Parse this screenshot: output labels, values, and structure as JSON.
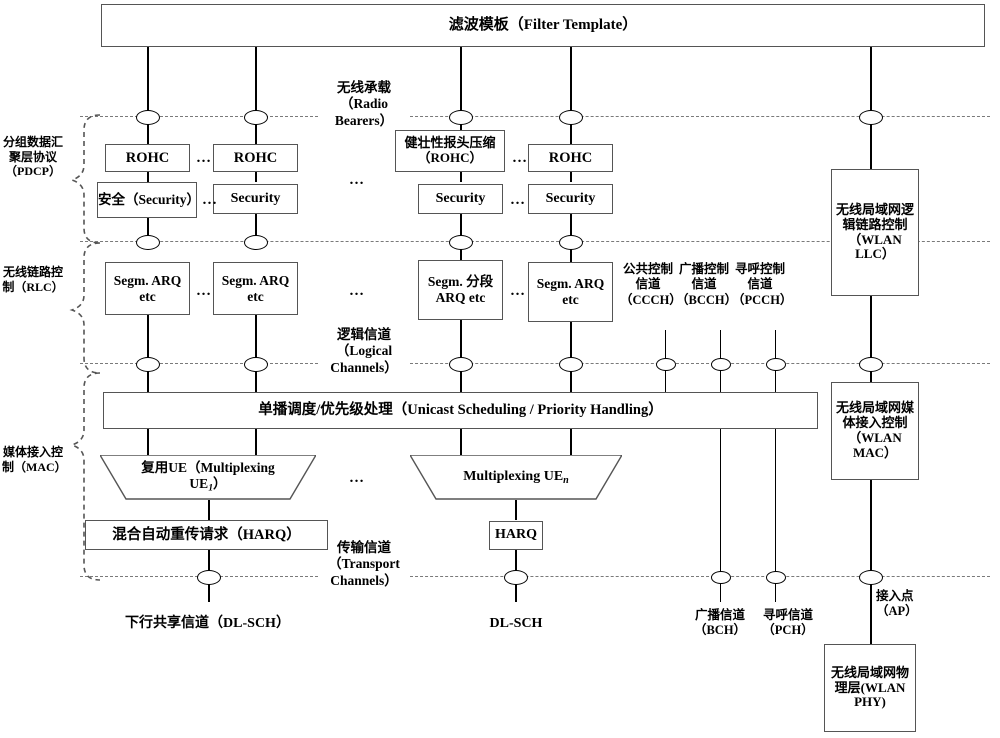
{
  "diagram": {
    "title": "滤波模板（Filter Template）",
    "layers": [
      {
        "id": "pdcp",
        "label": "分组数据汇聚层协议（PDCP）"
      },
      {
        "id": "rlc",
        "label": "无线链路控制（RLC）"
      },
      {
        "id": "mac",
        "label": "媒体接入控制（MAC）"
      }
    ],
    "interfaces": [
      {
        "id": "radio-bearers",
        "label": "无线承载（Radio Bearers）"
      },
      {
        "id": "logical-channels",
        "label": "逻辑信道（Logical Channels）"
      },
      {
        "id": "transport-channels",
        "label": "传输信道（Transport Channels）"
      }
    ],
    "pdcp_boxes": [
      {
        "id": "rohc-1",
        "label": "ROHC"
      },
      {
        "id": "rohc-2",
        "label": "ROHC"
      },
      {
        "id": "rohc-3",
        "label": "健壮性报头压缩（ROHC）"
      },
      {
        "id": "rohc-4",
        "label": "ROHC"
      },
      {
        "id": "security-1",
        "label": "安全（Security）"
      },
      {
        "id": "security-2",
        "label": "Security"
      },
      {
        "id": "security-3",
        "label": "Security"
      },
      {
        "id": "security-4",
        "label": "Security"
      }
    ],
    "rlc_boxes": [
      {
        "id": "segm-1",
        "label": "Segm. ARQ etc"
      },
      {
        "id": "segm-2",
        "label": "Segm. ARQ etc"
      },
      {
        "id": "segm-3",
        "label": "Segm. 分段ARQ etc"
      },
      {
        "id": "segm-4",
        "label": "Segm. ARQ etc"
      }
    ],
    "mac": {
      "scheduler": "单播调度/优先级处理（Unicast Scheduling / Priority Handling）",
      "mux_1_line1": "复用UE（Multiplexing",
      "mux_1_line2": "UE",
      "mux_1_sub": "1",
      "mux_1_tail": "）",
      "mux_n_text": "Multiplexing UE",
      "mux_n_sub": "n",
      "harq_1": "混合自动重传请求（HARQ）",
      "harq_n": "HARQ"
    },
    "control_channels": [
      {
        "id": "ccch",
        "label": "公共控制信道（CCCH）"
      },
      {
        "id": "bcch",
        "label": "广播控制信道（BCCH）"
      },
      {
        "id": "pcch",
        "label": "寻呼控制信道（PCCH）"
      }
    ],
    "transport_labels": [
      {
        "id": "dl-sch-1",
        "label": "下行共享信道（DL-SCH）"
      },
      {
        "id": "dl-sch-n",
        "label": "DL-SCH"
      },
      {
        "id": "bch",
        "label": "广播信道（BCH）"
      },
      {
        "id": "pch",
        "label": "寻呼信道（PCH）"
      },
      {
        "id": "ap",
        "label": "接入点（AP）"
      }
    ],
    "wlan_boxes": [
      {
        "id": "wlan-llc",
        "label": "无线局域网逻辑链路控制（WLAN LLC）"
      },
      {
        "id": "wlan-mac",
        "label": "无线局域网媒体接入控制（WLAN MAC）"
      },
      {
        "id": "wlan-phy",
        "label": "无线局域网物理层(WLAN PHY)"
      }
    ],
    "ellipsis": "…"
  }
}
